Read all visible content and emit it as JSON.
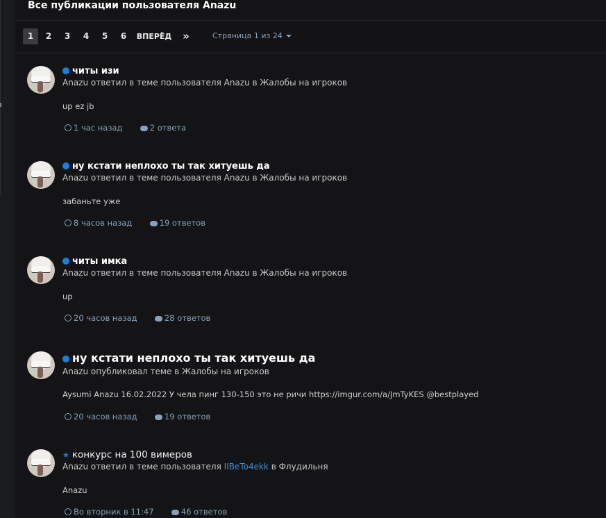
{
  "header": {
    "title": "Все публикации пользователя Anazu"
  },
  "pagination": {
    "pages": [
      "1",
      "2",
      "3",
      "4",
      "5",
      "6"
    ],
    "active": "1",
    "next_label": "ВПЕРЁД",
    "last_icon": "double-chevron-right-icon",
    "page_info": "Страница 1 из 24"
  },
  "posts": [
    {
      "title": "читы изи",
      "marker": "unread-dot",
      "subtitle": "Anazu ответил в теме пользователя Anazu в Жалобы на игроков",
      "body": "up ez jb",
      "time": "1 час назад",
      "replies": "2 ответа"
    },
    {
      "title": "ну кстати неплохо ты так хитуешь да",
      "marker": "unread-dot",
      "subtitle": "Anazu ответил в теме пользователя Anazu в Жалобы на игроков",
      "body": "забаньте уже",
      "time": "8 часов назад",
      "replies": "19 ответов"
    },
    {
      "title": "читы имка",
      "marker": "unread-dot",
      "subtitle": "Anazu ответил в теме пользователя Anazu в Жалобы на игроков",
      "body": "up",
      "time": "20 часов назад",
      "replies": "28 ответов"
    },
    {
      "title": "ну кстати неплохо ты так хитуешь да",
      "marker": "unread-dot",
      "subtitle": "Anazu опубликовал теме в Жалобы на игроков",
      "body": "Aysumi Anazu 16.02.2022 У чела пинг 130-150 это не ричи https://imgur.com/a/JmTyKES @bestplayed",
      "time": "20 часов назад",
      "replies": "19 ответов"
    },
    {
      "title": "конкурс на 100 вимеров",
      "marker": "star",
      "subtitle_prefix": "Anazu ответил в теме пользователя ",
      "subtitle_link": "IIBeTo4ekk",
      "subtitle_suffix": " в Флудильня",
      "body": "Anazu",
      "time": "Во вторник в 11:47",
      "replies": "46 ответов"
    }
  ],
  "colors": {
    "accent": "#1a7fe0",
    "meta": "#8aa0b8",
    "link": "#3d8fd6"
  }
}
